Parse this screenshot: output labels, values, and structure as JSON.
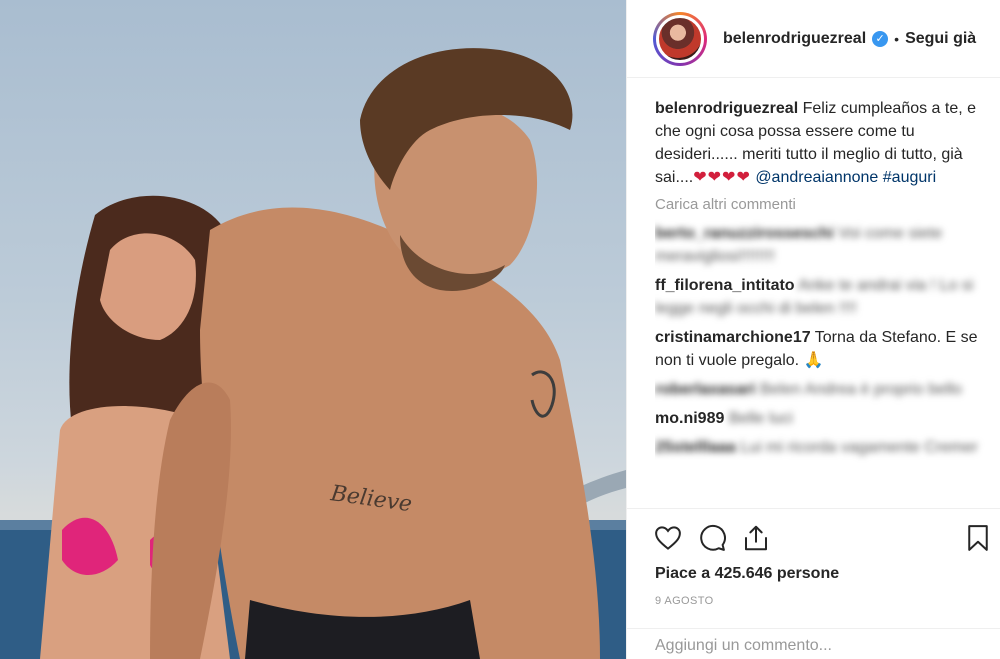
{
  "post": {
    "author": "belenrodriguezreal",
    "follow_state": "Segui già",
    "separator": "•",
    "verified_icon": "verified-check-icon"
  },
  "caption": {
    "author": "belenrodriguezreal",
    "text": "Feliz cumpleaños a te, e che ogni cosa possa essere come tu desideri...... meriti tutto il meglio di tutto, già sai....",
    "hearts": "❤❤❤❤",
    "mention": "@andreaiannone",
    "hashtag": "#auguri"
  },
  "load_more": "Carica altri commenti",
  "comments": [
    {
      "user": "berto_ranuzzirosseschi",
      "text": "Voi come siete meravigliosi!!!!!!!!"
    },
    {
      "user": "ff_filorena_intitato",
      "text": "Anke te andrai via ! Lo si legge negli occhi di belen !!!!"
    },
    {
      "user": "cristinamarchione17",
      "text": "Torna da Stefano. E se non ti vuole pregalo. 🙏"
    },
    {
      "user": "roberlaxasari",
      "text": "Belen Andrea è proprio bello"
    },
    {
      "user": "mo.ni989",
      "text": "Belle luci"
    },
    {
      "user": "25stelllaaa",
      "text": "Lui mi ricorda vagamente Cremer"
    }
  ],
  "likes": "Piace a 425.646 persone",
  "date": "9 AGOSTO",
  "add_comment_placeholder": "Aggiungi un commento...",
  "colors": {
    "accent_blue": "#3897f0",
    "link": "#003569",
    "muted": "#999999",
    "border": "#efefef"
  }
}
